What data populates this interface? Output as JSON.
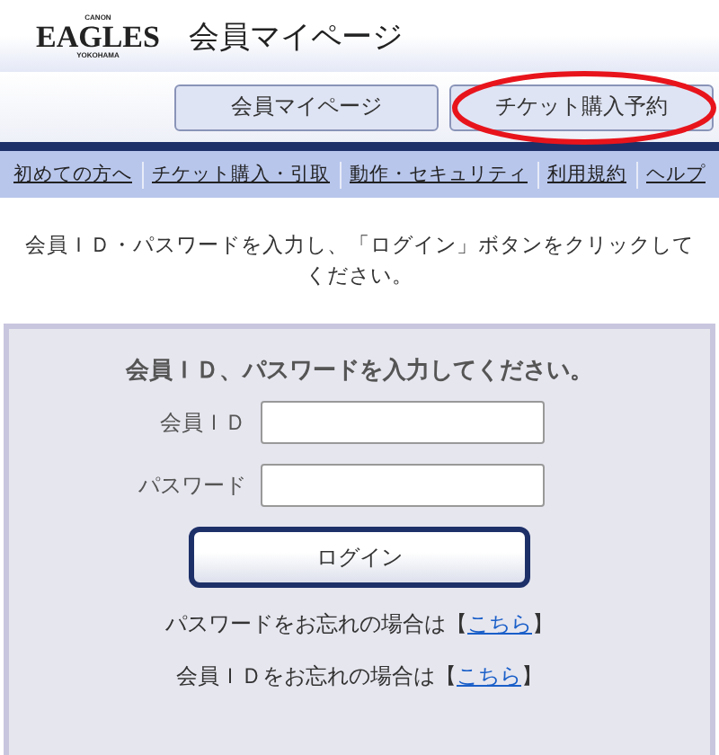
{
  "header": {
    "logo": {
      "top": "CANON",
      "main": "EAGLES",
      "bottom": "YOKOHAMA"
    },
    "title": "会員マイページ"
  },
  "nav_buttons": [
    {
      "label": "会員マイページ",
      "highlighted": false
    },
    {
      "label": "チケット購入予約",
      "highlighted": true
    }
  ],
  "links": [
    "初めての方へ",
    "チケット購入・引取",
    "動作・セキュリティ",
    "利用規約",
    "ヘルプ"
  ],
  "instruction": "会員ＩＤ・パスワードを入力し、「ログイン」ボタンをクリックしてください。",
  "login_panel": {
    "heading": "会員ＩＤ、パスワードを入力してください。",
    "fields": [
      {
        "label": "会員ＩＤ"
      },
      {
        "label": "パスワード"
      }
    ],
    "button": "ログイン",
    "forgot": [
      {
        "text": "パスワードをお忘れの場合は",
        "open": "【",
        "link": "こちら",
        "close": "】"
      },
      {
        "text": "会員ＩＤをお忘れの場合は",
        "open": "【",
        "link": "こちら",
        "close": "】"
      }
    ]
  }
}
